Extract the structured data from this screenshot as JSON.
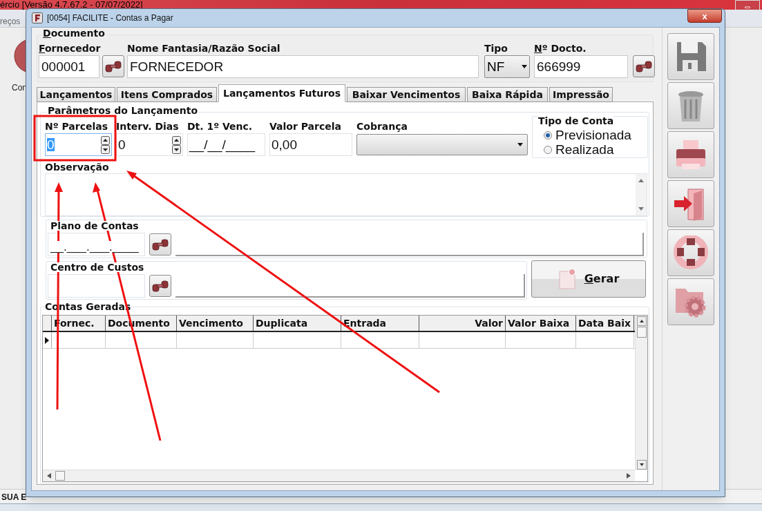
{
  "background_app": {
    "title": "ércio [Versão 4.7.67.2 - 07/07/2022]",
    "menu_item": "reços",
    "shortcut_label": "Con",
    "status_text": "SUA E",
    "restore_button": "⇔"
  },
  "window": {
    "title": "[0054] FACILITE - Contas a Pagar",
    "close": "x"
  },
  "documento": {
    "legend": "Documento",
    "legend_mnemonic": true,
    "fields": [
      {
        "label": "Fornecedor",
        "mnemonic": true,
        "value": "000001",
        "kind": "lookup"
      },
      {
        "label": "Nome Fantasia/Razão Social",
        "mnemonic": false,
        "value": "FORNECEDOR",
        "kind": "text"
      },
      {
        "label": "Tipo",
        "mnemonic": false,
        "value": "NF",
        "kind": "select"
      },
      {
        "label": "Nº Docto.",
        "mnemonic": true,
        "value": "666999",
        "kind": "lookup"
      }
    ]
  },
  "tabs": [
    {
      "label": "Lançamentos",
      "selected": false
    },
    {
      "label": "Itens Comprados",
      "selected": false
    },
    {
      "label": "Lançamentos Futuros",
      "selected": true
    },
    {
      "label": "Baixar Vencimentos",
      "selected": false
    },
    {
      "label": "Baixa Rápida",
      "selected": false
    },
    {
      "label": "Impressão",
      "selected": false
    }
  ],
  "parametros": {
    "legend": "Parâmetros do Lançamento",
    "fields": [
      {
        "label": "Nº Parcelas",
        "value": "0",
        "kind": "spin",
        "focused": true
      },
      {
        "label": "Interv. Dias",
        "value": "0",
        "kind": "spin",
        "focused": false
      },
      {
        "label": "Dt. 1º Venc.",
        "value": "__/__/____",
        "kind": "text",
        "focused": false
      },
      {
        "label": "Valor Parcela",
        "value": "0,00",
        "kind": "text",
        "focused": false
      },
      {
        "label": "Cobrança",
        "kind": "select",
        "focused": false
      }
    ],
    "tipo_de_conta": {
      "legend": "Tipo de Conta",
      "options": [
        {
          "label": "Previsionada",
          "selected": true
        },
        {
          "label": "Realizada",
          "selected": false
        }
      ]
    },
    "observacao_label": "Observação"
  },
  "plano_de_contas": {
    "legend": "Plano de Contas",
    "code": "__.___.___.____"
  },
  "centro_de_custos": {
    "legend": "Centro de Custos"
  },
  "gerar_button": {
    "label": "Gerar",
    "mnemonic": true
  },
  "contas_geradas": {
    "legend": "Contas Geradas",
    "columns": [
      {
        "label": "Fornec."
      },
      {
        "label": "Documento"
      },
      {
        "label": "Vencimento"
      },
      {
        "label": "Duplicata"
      },
      {
        "label": "Entrada"
      },
      {
        "label": "Valor"
      },
      {
        "label": "Valor Baixa"
      },
      {
        "label": "Data Baix"
      }
    ],
    "rows": [
      {
        "current": true
      }
    ]
  },
  "toolbar": [
    {
      "kind": "save"
    },
    {
      "kind": "delete"
    },
    {
      "kind": "print"
    },
    {
      "kind": "exit"
    },
    {
      "kind": "help"
    },
    {
      "kind": "settings"
    }
  ]
}
